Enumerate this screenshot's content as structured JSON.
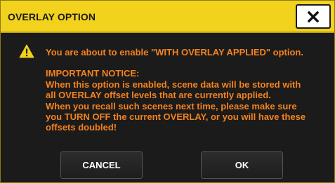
{
  "dialog": {
    "title": "OVERLAY OPTION",
    "close_icon": "close-x-icon",
    "warning_icon": "warning-triangle-icon",
    "message": {
      "line1": "You are about to enable \"WITH OVERLAY APPLIED\" option.",
      "notice_heading": "IMPORTANT NOTICE:",
      "notice_lines": [
        "When this option is enabled, scene data will be stored with",
        "all OVERLAY offset levels that are currently applied.",
        "When you recall such scenes next time, please make sure",
        "you TURN OFF the current OVERLAY, or you will have these",
        "offsets doubled!"
      ]
    },
    "buttons": {
      "cancel_label": "CANCEL",
      "ok_label": "OK"
    }
  },
  "colors": {
    "title_bar": "#f2d21c",
    "message_text": "#f5821f",
    "background": "#1b1b1b",
    "warning_icon": "#f2d21c"
  }
}
